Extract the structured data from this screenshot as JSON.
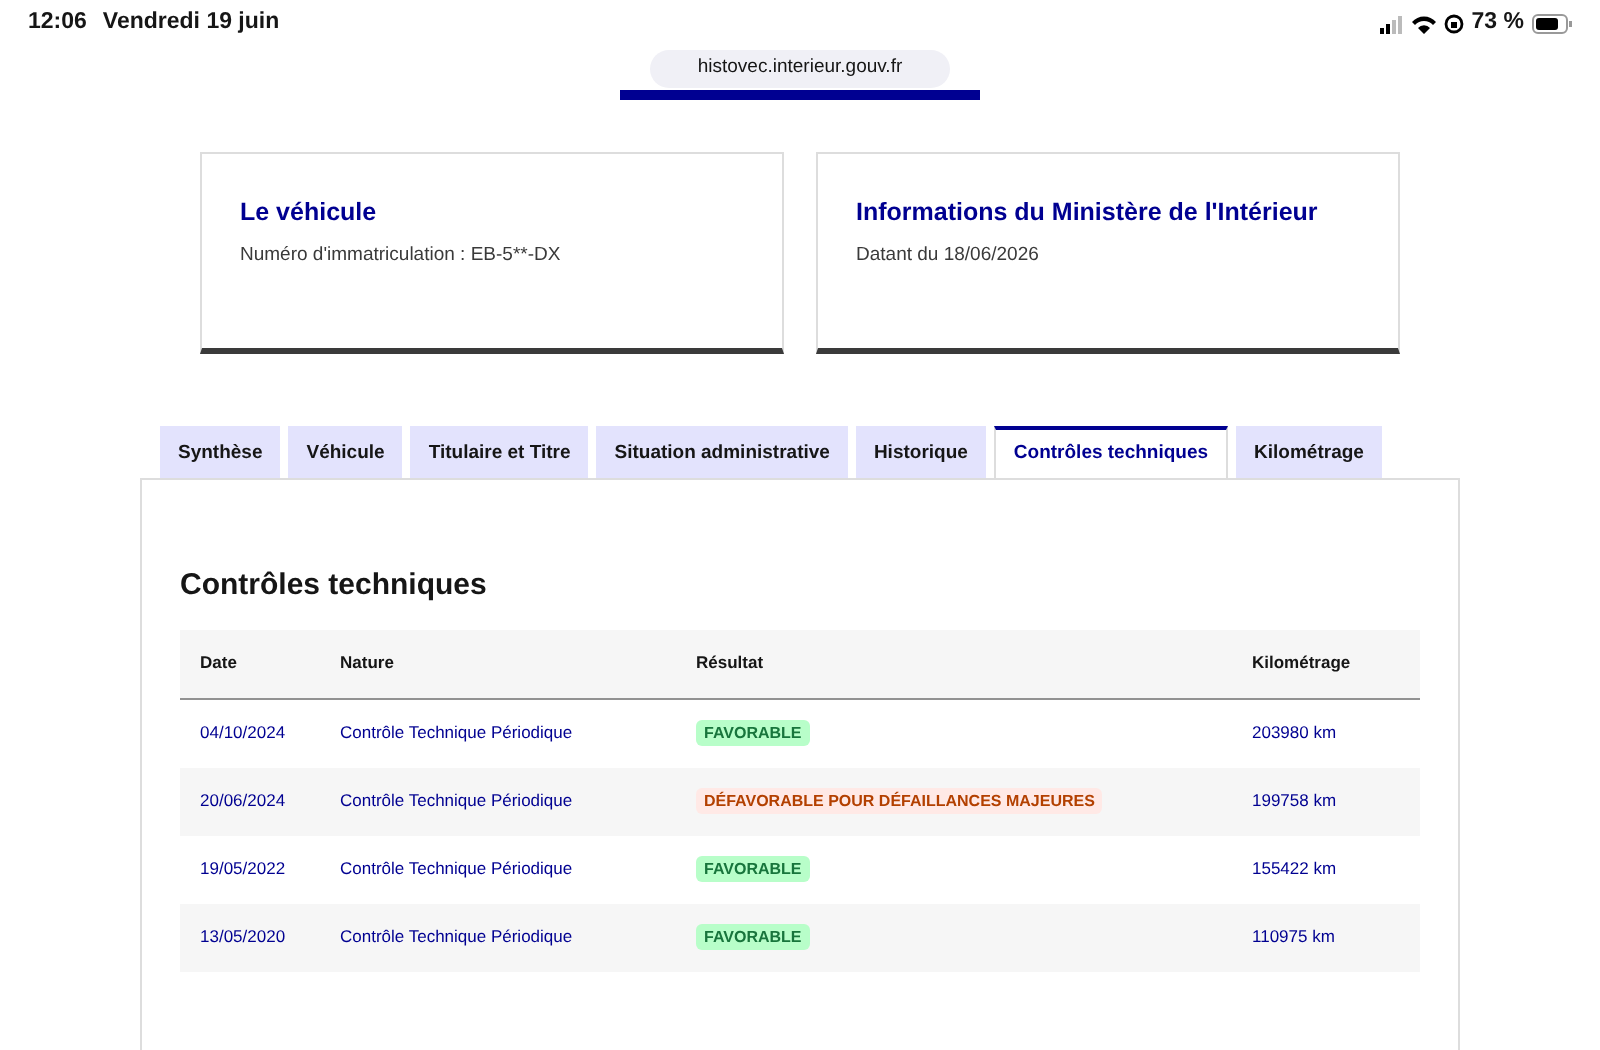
{
  "status_bar": {
    "time": "12:06",
    "date": "Vendredi 19 juin",
    "battery_text": "73 %"
  },
  "address_bar": {
    "url": "histovec.interieur.gouv.fr"
  },
  "cards": [
    {
      "title": "Le véhicule",
      "text": "Numéro d'immatriculation : EB-5**-DX"
    },
    {
      "title": "Informations du Ministère de l'Intérieur",
      "text": "Datant du 18/06/2026"
    }
  ],
  "tabs": [
    {
      "label": "Synthèse",
      "selected": false
    },
    {
      "label": "Véhicule",
      "selected": false
    },
    {
      "label": "Titulaire et Titre",
      "selected": false
    },
    {
      "label": "Situation administrative",
      "selected": false
    },
    {
      "label": "Historique",
      "selected": false
    },
    {
      "label": "Contrôles techniques",
      "selected": true
    },
    {
      "label": "Kilométrage",
      "selected": false
    }
  ],
  "section_title": "Contrôles techniques",
  "table": {
    "columns": [
      "Date",
      "Nature",
      "Résultat",
      "Kilométrage"
    ],
    "rows": [
      {
        "date": "04/10/2024",
        "nature": "Contrôle Technique Périodique",
        "result": "FAVORABLE",
        "kind": "success",
        "mileage": "203980 km"
      },
      {
        "date": "20/06/2024",
        "nature": "Contrôle Technique Périodique",
        "result": "DÉFAVORABLE POUR DÉFAILLANCES MAJEURES",
        "kind": "error",
        "mileage": "199758 km"
      },
      {
        "date": "19/05/2022",
        "nature": "Contrôle Technique Périodique",
        "result": "FAVORABLE",
        "kind": "success",
        "mileage": "155422 km"
      },
      {
        "date": "13/05/2020",
        "nature": "Contrôle Technique Périodique",
        "result": "FAVORABLE",
        "kind": "success",
        "mileage": "110975 km"
      }
    ]
  }
}
